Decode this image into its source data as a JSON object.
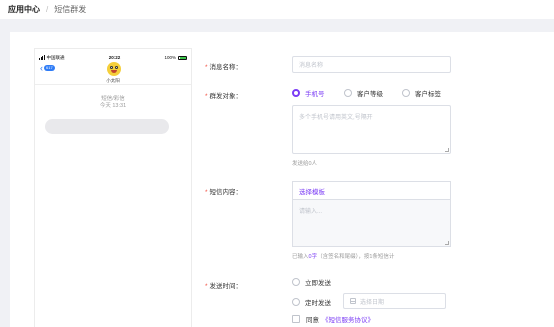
{
  "breadcrumb": {
    "root": "应用中心",
    "separator": "/",
    "current": "短信群发"
  },
  "phone": {
    "carrier": "中国联通",
    "time": "20:22",
    "battery": "100%",
    "back_badge": "617",
    "contact_name": "小太阳",
    "sender": "短信/彩信",
    "timestamp": "今天 13:31"
  },
  "form": {
    "name": {
      "label": "消息名称：",
      "placeholder": "消息名称"
    },
    "target": {
      "label": "群发对象：",
      "options": [
        "手机号",
        "客户等级",
        "客户标签"
      ],
      "selected": "手机号",
      "placeholder": "多个手机号请用英文,号隔开",
      "hint": "发送给0人"
    },
    "content": {
      "label": "短信内容：",
      "template_link": "选择模板",
      "placeholder": "请输入...",
      "count_prefix": "已输入",
      "count_value": "0字",
      "count_suffix": "（含签名和尾缀），按1条短信计"
    },
    "send_time": {
      "label": "发送时间：",
      "options": [
        "立即发送",
        "定时发送"
      ],
      "date_placeholder": "选择日期"
    },
    "agree": {
      "text": "同意",
      "link": "《短信服务协议》"
    }
  },
  "colors": {
    "accent": "#7b3cf5",
    "required": "#f25042",
    "background": "#f0f1f5"
  }
}
